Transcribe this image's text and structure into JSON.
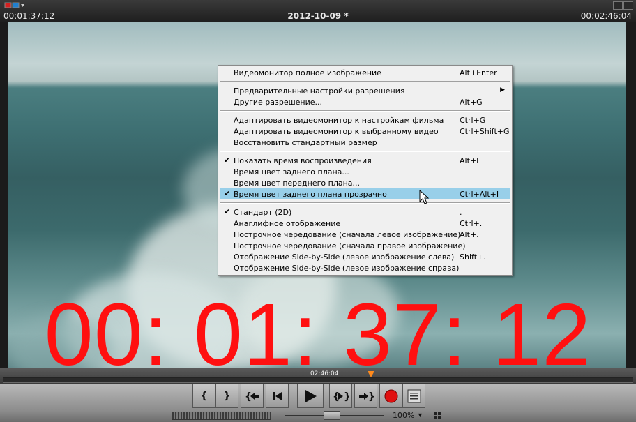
{
  "header": {
    "timecode_left": "00:01:37:12",
    "title": "2012-10-09 *",
    "timecode_right": "00:02:46:04"
  },
  "overlay": {
    "timecode": "00: 01: 37: 12",
    "color": "#ff1010"
  },
  "context_menu": {
    "groups": [
      [
        {
          "label": "Видеомонитор полное изображение",
          "shortcut": "Alt+Enter"
        }
      ],
      [
        {
          "label": "Предварительные настройки разрешения",
          "shortcut": "",
          "submenu": true
        },
        {
          "label": "Другие разрешение...",
          "shortcut": "Alt+G"
        }
      ],
      [
        {
          "label": "Адаптировать видеомонитор к настройкам фильма",
          "shortcut": "Ctrl+G"
        },
        {
          "label": "Адаптировать видеомонитор к выбранному видео",
          "shortcut": "Ctrl+Shift+G"
        },
        {
          "label": "Восстановить стандартный размер",
          "shortcut": ""
        }
      ],
      [
        {
          "label": "Показать время воспроизведения",
          "shortcut": "Alt+I",
          "checked": true
        },
        {
          "label": "Время цвет заднего плана...",
          "shortcut": ""
        },
        {
          "label": "Время цвет переднего плана...",
          "shortcut": ""
        },
        {
          "label": "Время цвет заднего плана прозрачно",
          "shortcut": "Ctrl+Alt+I",
          "checked": true,
          "highlighted": true
        }
      ],
      [
        {
          "label": "Стандарт (2D)",
          "shortcut": ".",
          "checked": true
        },
        {
          "label": "Анаглифное отображение",
          "shortcut": "Ctrl+."
        },
        {
          "label": "Построчное чередование (сначала левое изображение)",
          "shortcut": "Alt+."
        },
        {
          "label": "Построчное чередование (сначала правое изображение)",
          "shortcut": ""
        },
        {
          "label": "Отображение Side-by-Side (левое изображение слева)",
          "shortcut": "Shift+."
        },
        {
          "label": "Отображение Side-by-Side (левое изображение справа)",
          "shortcut": ""
        }
      ]
    ],
    "highlight_color": "#98cfe9"
  },
  "timeline": {
    "position_label": "02:46:04",
    "marker_color": "#ff8a1c"
  },
  "transport": {
    "buttons": [
      {
        "name": "set-in-button",
        "glyph": "{"
      },
      {
        "name": "set-out-button",
        "glyph": "}"
      },
      {
        "name": "go-to-in-button",
        "icon": "go-to-in-icon"
      },
      {
        "name": "previous-marker-button",
        "icon": "skip-back-icon"
      },
      {
        "name": "play-button",
        "icon": "play-icon"
      },
      {
        "name": "go-to-out-button",
        "icon": "go-to-out-icon"
      },
      {
        "name": "next-marker-button",
        "icon": "skip-forward-icon"
      },
      {
        "name": "record-button",
        "icon": "record-icon",
        "color": "#e01010"
      },
      {
        "name": "menu-list-button",
        "icon": "list-icon"
      }
    ]
  },
  "status": {
    "zoom": "100%"
  }
}
